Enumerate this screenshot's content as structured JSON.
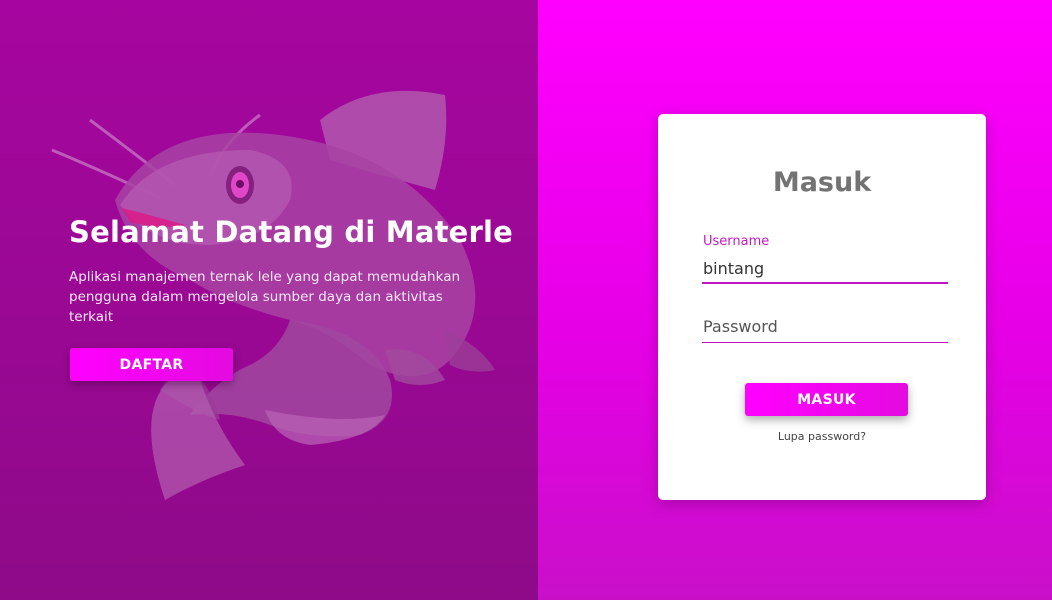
{
  "welcome": {
    "title": "Selamat Datang di Materle",
    "description": "Aplikasi manajemen ternak lele yang dapat memudahkan pengguna dalam mengelola sumber daya dan aktivitas terkait",
    "register_label": "DAFTAR"
  },
  "login": {
    "title": "Masuk",
    "username_label": "Username",
    "username_value": "bintang",
    "password_placeholder": "Password",
    "submit_label": "MASUK",
    "forgot_label": "Lupa password?"
  },
  "colors": {
    "accent": "#ff00ff",
    "left_background": "#a6069f",
    "right_background": "#ff00ff"
  },
  "icons": {
    "illustration": "catfish-illustration"
  }
}
